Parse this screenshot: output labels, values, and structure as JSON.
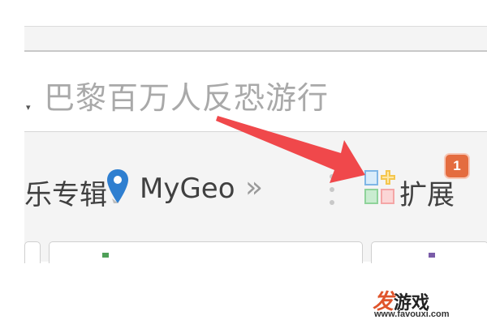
{
  "address_bar": {
    "text": "巴黎百万人反恐游行",
    "dropdown_glyph": "▾"
  },
  "bookmarks": {
    "items": [
      {
        "label": "乐专辑"
      },
      {
        "label": "MyGeo",
        "icon": "map-pin-icon"
      }
    ],
    "overflow_glyph": "»"
  },
  "extensions": {
    "label": "扩展",
    "badge_count": "1",
    "icon": "extensions-grid-icon"
  },
  "annotation": {
    "arrow_color": "#f0484b"
  },
  "watermark": {
    "title_prefix": "发",
    "title_rest": "游戏",
    "url": "www.favouxi.com"
  },
  "colors": {
    "badge": "#e46c3f",
    "ext_tiles": [
      "#7fb6e6",
      "#f4c64e",
      "#8fd39a",
      "#f4a6a6"
    ]
  }
}
